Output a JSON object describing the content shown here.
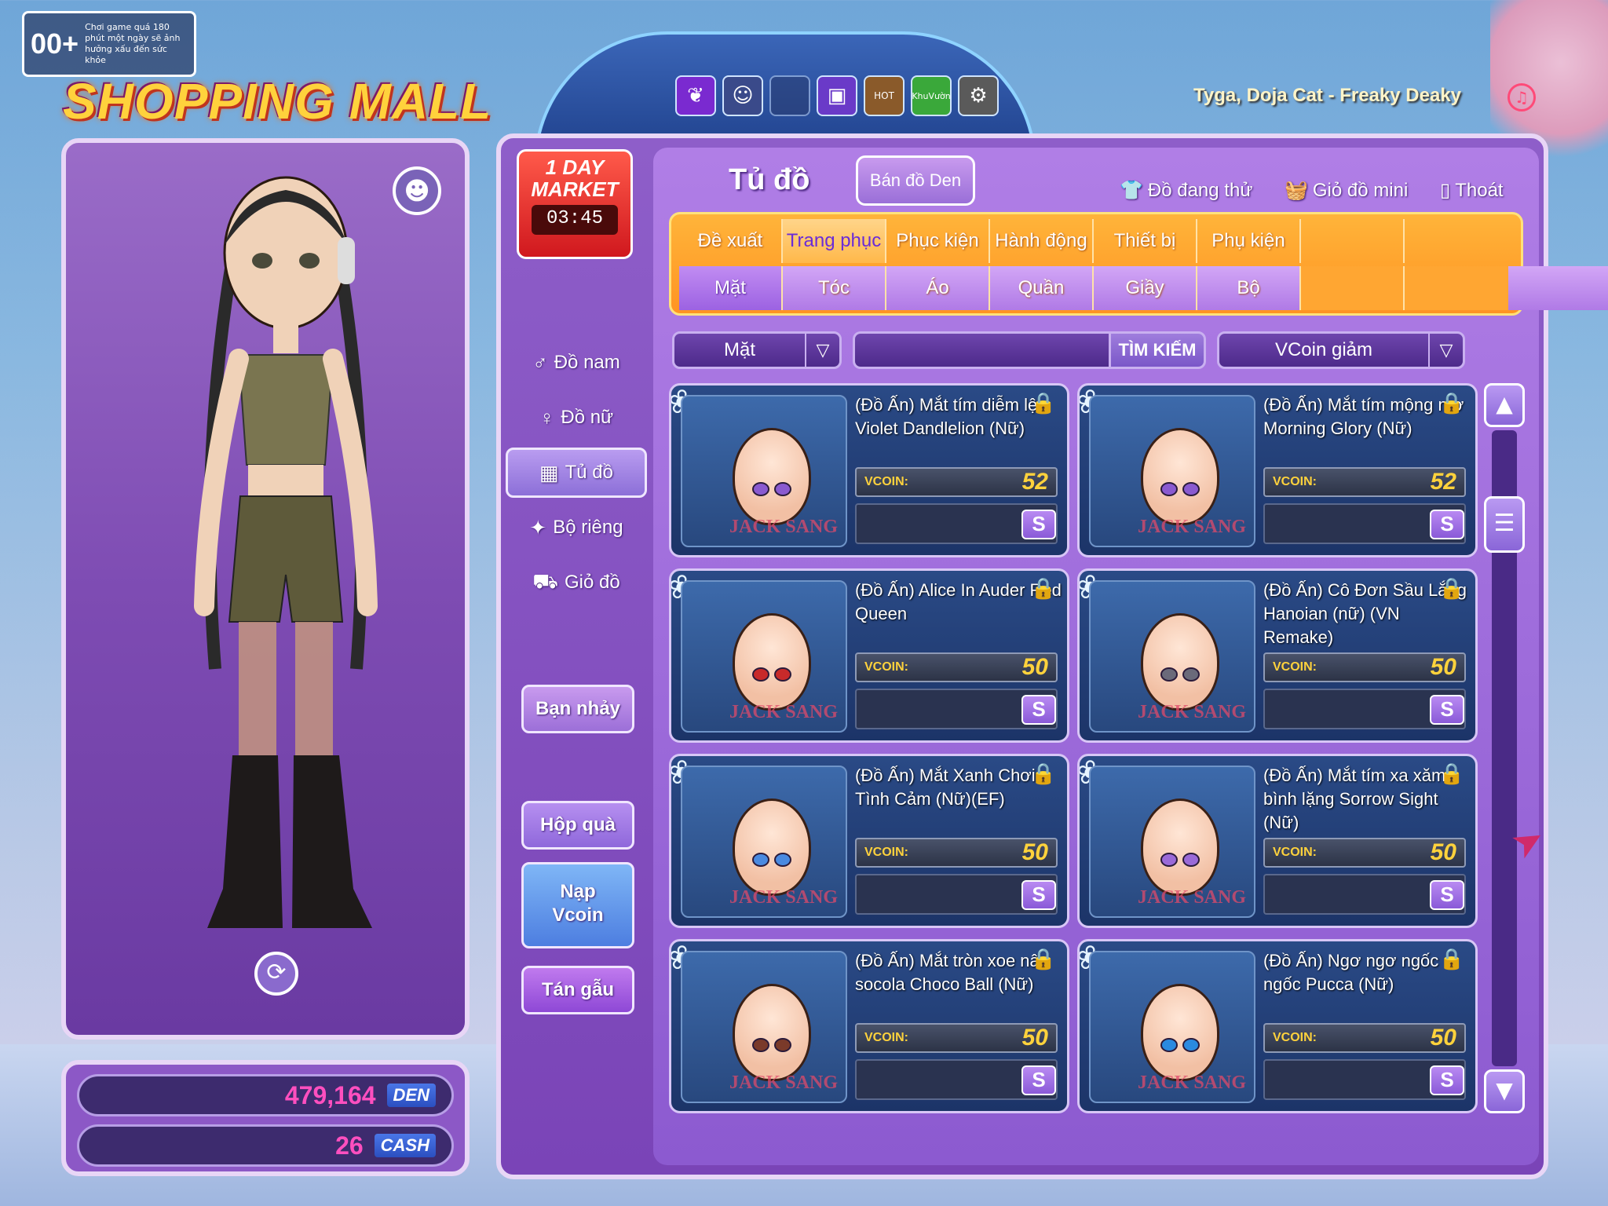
{
  "age_badge": {
    "rating": "00+",
    "notice": "Chơi game quá 180 phút một ngày sẽ ảnh hưởng xấu đến sức khỏe"
  },
  "logo": "SHOPPING MALL",
  "now_playing": "Tyga, Doja Cat - Freaky Deaky",
  "top_icons": [
    "butterfly-icon",
    "pet-icon",
    "tv-icon",
    "hot-chest-icon",
    "garden-icon",
    "settings-icon"
  ],
  "top_icon_labels": {
    "hot": "HOT",
    "garden": "KhuVườn"
  },
  "market": {
    "title_line1": "1 DAY",
    "title_line2": "MARKET",
    "timer": "03:45"
  },
  "wallet": {
    "den_value": "479,164",
    "den_unit": "DEN",
    "cash_value": "26",
    "cash_unit": "CASH"
  },
  "header": {
    "title": "Tủ đồ",
    "den_button": "Bán đồ Den",
    "trying": "Đồ đang thử",
    "mini_cart": "Giỏ đồ mini",
    "exit": "Thoát"
  },
  "side_menu": [
    {
      "label": "Đồ nam",
      "icon": "male-icon"
    },
    {
      "label": "Đồ nữ",
      "icon": "female-icon"
    },
    {
      "label": "Tủ đồ",
      "icon": "wardrobe-icon"
    },
    {
      "label": "Bộ riêng",
      "icon": "set-icon"
    },
    {
      "label": "Giỏ đồ",
      "icon": "cart-icon"
    }
  ],
  "side_buttons": {
    "dance_partner": "Bạn nhảy",
    "gift_box": "Hộp quà",
    "topup_line1": "Nạp",
    "topup_line2": "Vcoin",
    "chat": "Tán gẫu"
  },
  "tabs_main": [
    "Đề xuất",
    "Trang phục",
    "Phục kiện",
    "Hành động",
    "Thiết bị",
    "Phụ kiện",
    "",
    ""
  ],
  "tabs_sub": [
    "Mặt",
    "Tóc",
    "Áo",
    "Quần",
    "Giầy",
    "Bộ",
    "",
    ""
  ],
  "filters": {
    "category": "Mặt",
    "search_button": "TÌM KIẾM",
    "search_value": "",
    "sort": "VCoin giảm"
  },
  "items": [
    {
      "name": "(Đồ Ấn) Mắt tím diễm lệ Violet Dandlelion (Nữ)",
      "currency": "VCOIN:",
      "price": "52",
      "eye_color": "#8a5ad0",
      "brand": "JACK SANG"
    },
    {
      "name": "(Đồ Ấn) Mắt tím mộng mơ Morning Glory (Nữ)",
      "currency": "VCOIN:",
      "price": "52",
      "eye_color": "#8a5ad0",
      "brand": "JACK SANG"
    },
    {
      "name": "(Đồ Ấn) Alice In Auder Red Queen",
      "currency": "VCOIN:",
      "price": "50",
      "eye_color": "#c82a2a",
      "brand": "JACK SANG"
    },
    {
      "name": "(Đồ Ấn) Cô Đơn Sầu Lắng Hanoian (nữ) (VN Remake)",
      "currency": "VCOIN:",
      "price": "50",
      "eye_color": "#6a6a7a",
      "brand": "JACK SANG"
    },
    {
      "name": "(Đồ Ấn) Mắt Xanh Chơi Tình Cảm (Nữ)(EF)",
      "currency": "VCOIN:",
      "price": "50",
      "eye_color": "#4a8ae0",
      "brand": "JACK SANG"
    },
    {
      "name": "(Đồ Ấn) Mắt tím xa xăm bình lặng Sorrow Sight (Nữ)",
      "currency": "VCOIN:",
      "price": "50",
      "eye_color": "#9a6ad8",
      "brand": "JACK SANG"
    },
    {
      "name": "(Đồ Ấn) Mắt tròn xoe nâu socola Choco Ball (Nữ)",
      "currency": "VCOIN:",
      "price": "50",
      "eye_color": "#7a3a2a",
      "brand": "JACK SANG"
    },
    {
      "name": "(Đồ Ấn) Ngơ ngơ ngốc ngốc Pucca (Nữ)",
      "currency": "VCOIN:",
      "price": "50",
      "eye_color": "#2a8ae0",
      "brand": "JACK SANG"
    }
  ],
  "item_action_label": "S",
  "colors": {
    "accent_orange": "#ff9a2a",
    "panel_purple": "#8e5ec9",
    "price_gold": "#ffd23c",
    "den_pink": "#ff4fbf"
  }
}
